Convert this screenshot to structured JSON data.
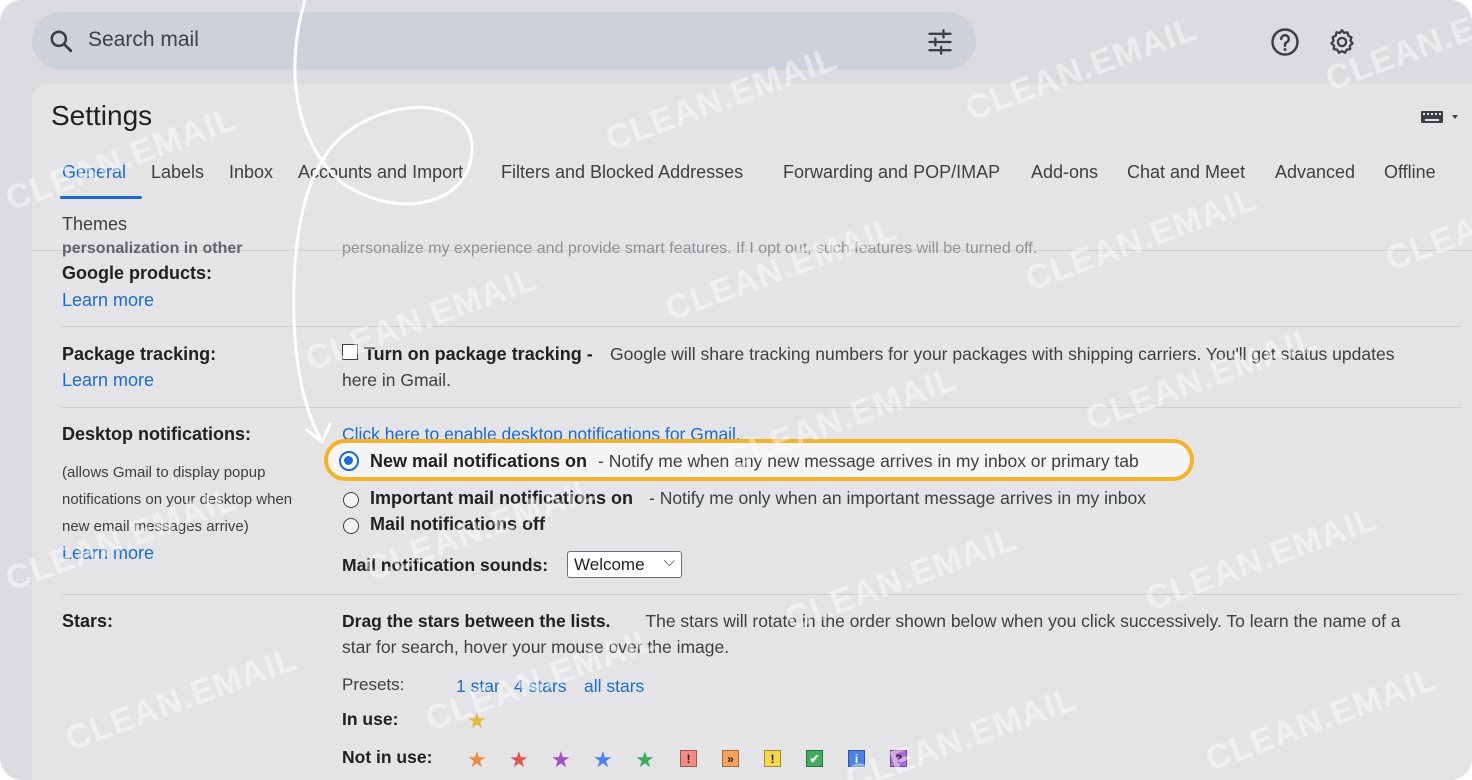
{
  "search": {
    "placeholder": "Search mail"
  },
  "header": {
    "help_icon": "help-icon",
    "settings_icon": "gear-icon"
  },
  "settings": {
    "title": "Settings",
    "tabs": [
      {
        "label": "General",
        "active": true
      },
      {
        "label": "Labels"
      },
      {
        "label": "Inbox"
      },
      {
        "label": "Accounts and Import"
      },
      {
        "label": "Filters and Blocked Addresses"
      },
      {
        "label": "Forwarding and POP/IMAP"
      },
      {
        "label": "Add-ons"
      },
      {
        "label": "Chat and Meet"
      },
      {
        "label": "Advanced"
      },
      {
        "label": "Offline"
      },
      {
        "label": "Themes"
      }
    ]
  },
  "personalization": {
    "label_cut": "personalization in other",
    "label": "Google products:",
    "learn_more": "Learn more",
    "desc_cut": "personalize my experience and provide smart features. If I opt out, such features will be turned off."
  },
  "package": {
    "label": "Package tracking:",
    "learn_more": "Learn more",
    "option_bold": "Turn on package tracking -",
    "option_text": "Google will share tracking numbers for your packages with shipping carriers. You'll get status updates",
    "option_text2": "here in Gmail."
  },
  "desktop": {
    "label": "Desktop notifications:",
    "help_lines": [
      "(allows Gmail to display popup",
      "notifications on your desktop when",
      "new email messages arrive)"
    ],
    "learn_more": "Learn more",
    "enable_link": "Click here to enable desktop notifications for Gmail.",
    "options": [
      {
        "bold": "New mail notifications on",
        "text": " - Notify me when any new message arrives in my inbox or primary tab",
        "selected": true
      },
      {
        "bold": "Important mail notifications on",
        "text": " - Notify me only when an important message arrives in my inbox"
      },
      {
        "bold": "Mail notifications off",
        "text": ""
      }
    ],
    "sound_label": "Mail notification sounds:",
    "sound_value": "Welcome"
  },
  "stars": {
    "label": "Stars:",
    "desc_bold": "Drag the stars between the lists.",
    "desc_text": "  The stars will rotate in the order shown below when you click successively. To learn the name of a",
    "desc_text2": "star for search, hover your mouse over the image.",
    "presets_label": "Presets:",
    "presets": [
      "1 star",
      "4 stars",
      "all stars"
    ],
    "in_use_label": "In use:",
    "not_in_use_label": "Not in use:",
    "colors": {
      "yellow": "#e6b83a",
      "orange": "#f08a3c",
      "red": "#e0574f",
      "purple": "#a050c8",
      "blue": "#4a82e8",
      "green": "#3dae5b"
    },
    "box_glyphs": [
      "!",
      "»",
      "!",
      "✔",
      "i",
      "?"
    ]
  },
  "watermark": "CLEAN.EMAIL"
}
